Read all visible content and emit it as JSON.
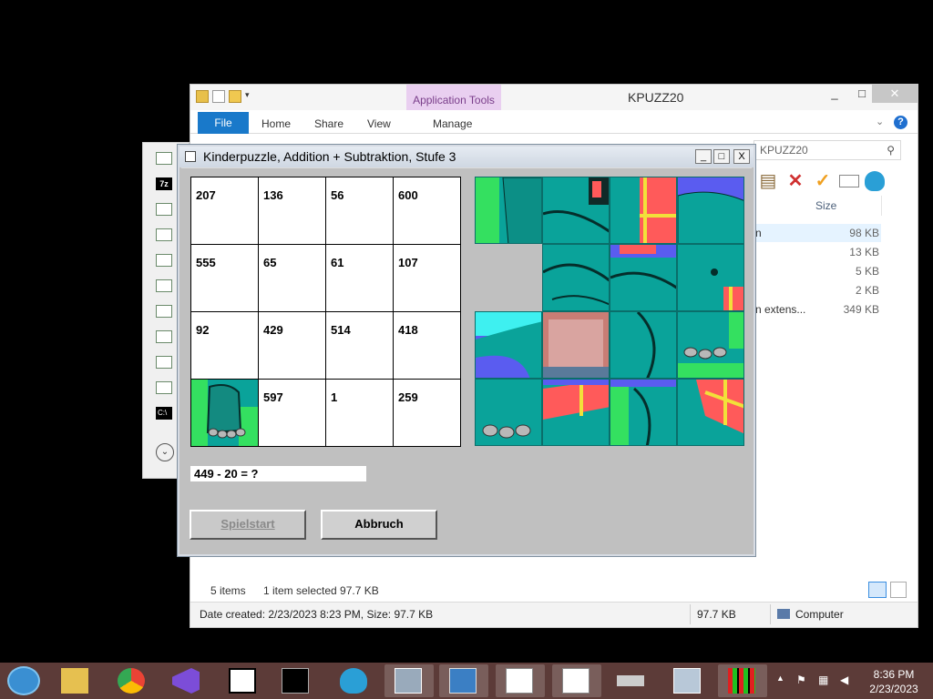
{
  "explorer": {
    "title": "KPUZZ20",
    "app_tools": "Application Tools",
    "tabs": [
      "File",
      "Home",
      "Share",
      "View",
      "Manage"
    ],
    "search_placeholder": "KPUZZ20",
    "size_header": "Size",
    "files": [
      {
        "name": "n",
        "size": "98 KB",
        "selected": true
      },
      {
        "name": "",
        "size": "13 KB"
      },
      {
        "name": "",
        "size": "5 KB"
      },
      {
        "name": "",
        "size": "2 KB"
      },
      {
        "name": "n extens...",
        "size": "349 KB"
      }
    ],
    "status": {
      "items": "5 items",
      "selected": "1 item selected  97.7 KB",
      "details": "Date created: 2/23/2023 8:23 PM, Size: 97.7 KB",
      "size": "97.7 KB",
      "location": "Computer"
    }
  },
  "puzzle": {
    "title": "Kinderpuzzle, Addition + Subtraktion, Stufe  3",
    "grid": [
      [
        "207",
        "136",
        "56",
        "600"
      ],
      [
        "555",
        "65",
        "61",
        "107"
      ],
      [
        "92",
        "429",
        "514",
        "418"
      ],
      [
        "",
        "597",
        "1",
        "259"
      ]
    ],
    "question": "449 - 20 = ?",
    "buttons": {
      "start": "Spielstart",
      "abort": "Abbruch"
    }
  },
  "window_controls": {
    "minimize": "_",
    "maximize": "□",
    "close": "X"
  },
  "taskbar": {
    "clock_time": "8:36 PM",
    "clock_date": "2/23/2023",
    "items": [
      "start-orb",
      "file-explorer",
      "chrome",
      "visual-studio",
      "7zip",
      "cmd",
      "shell",
      "vcdi",
      "image-viewer",
      "window-a",
      "window-b",
      "drive",
      "system-monitor",
      "kpuzz"
    ]
  },
  "colors": {
    "taskbar": "#5c3b38",
    "puzzle_bg": "#c0c0c0",
    "tile_teal": "#0aa39a",
    "tile_green": "#34e060",
    "tile_red": "#ff5a5a",
    "tile_blue": "#5a5cf0",
    "tile_yellow": "#f2e03a",
    "accent": "#1979ca"
  }
}
